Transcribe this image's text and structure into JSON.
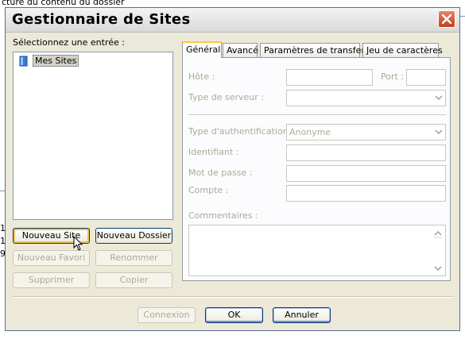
{
  "background": {
    "top_text": "cture du contenu du dossier",
    "left_snippets": [
      "1,",
      "1,",
      "9,"
    ]
  },
  "dialog": {
    "title": "Gestionnaire de Sites",
    "tree_label": "Sélectionnez une entrée :",
    "tree_items": [
      "Mes Sites"
    ],
    "buttons": {
      "new_site": "Nouveau Site",
      "new_folder": "Nouveau Dossier",
      "new_bookmark": "Nouveau Favori",
      "rename": "Renommer",
      "delete": "Supprimer",
      "copy": "Copier",
      "connect": "Connexion",
      "ok": "OK",
      "cancel": "Annuler"
    },
    "tabs": [
      "Général",
      "Avancé",
      "Paramètres de transfert",
      "Jeu de caractères"
    ],
    "active_tab": "Général",
    "form": {
      "host_label": "Hôte :",
      "host_value": "",
      "port_label": "Port :",
      "port_value": "",
      "server_type_label": "Type de serveur :",
      "server_type_value": "",
      "auth_type_label": "Type d'authentification :",
      "auth_type_value": "Anonyme",
      "user_label": "Identifiant :",
      "user_value": "",
      "password_label": "Mot de passe :",
      "password_value": "",
      "account_label": "Compte :",
      "account_value": "",
      "comments_label": "Commentaires :",
      "comments_value": ""
    },
    "colors": {
      "dialog_bg": "#ece9d8",
      "panel_bg": "#fcfcfe",
      "active_tab_accent": "#ffc83c",
      "disabled_text": "#aca899",
      "close_button": "#c0401e"
    }
  }
}
